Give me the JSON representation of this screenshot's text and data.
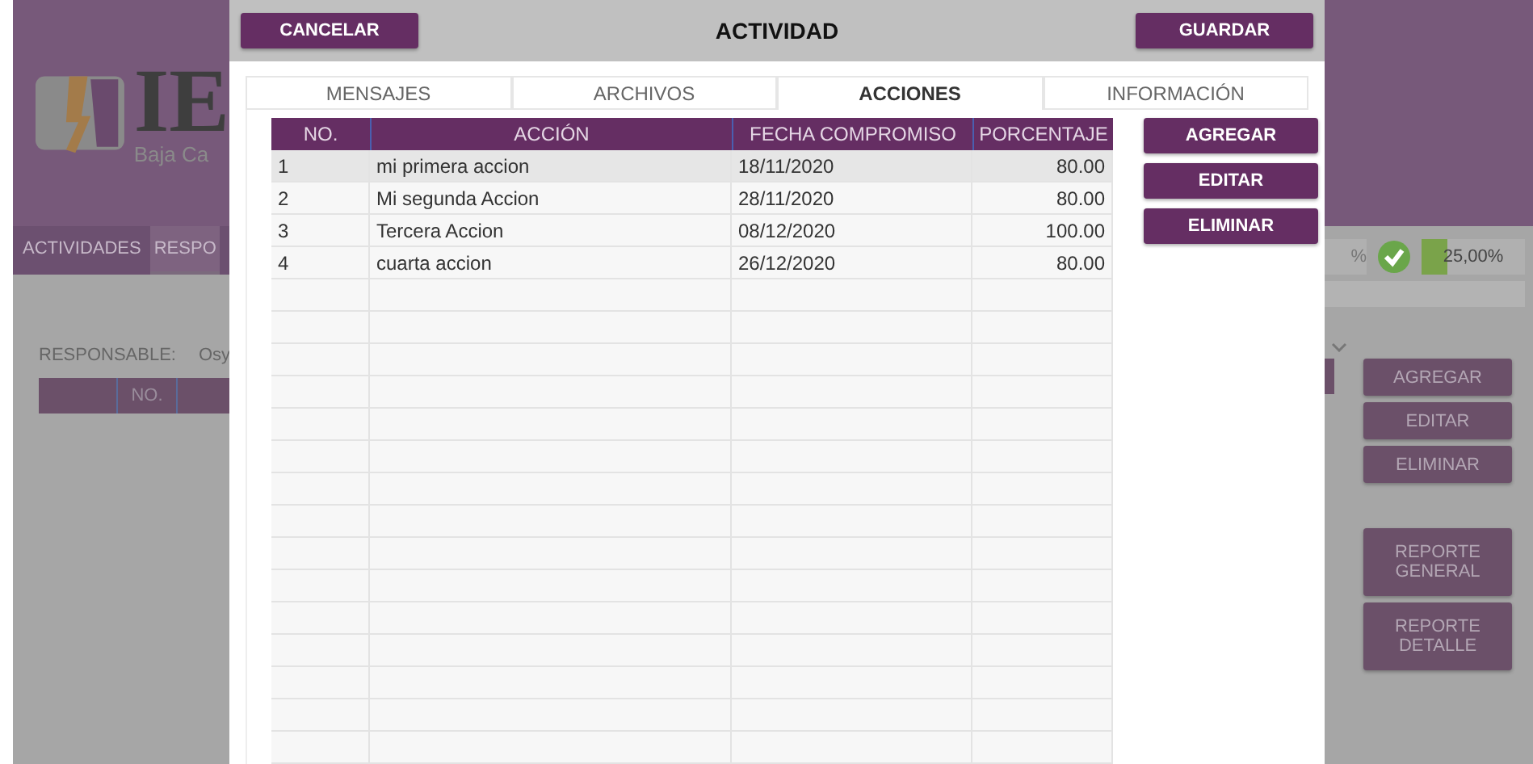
{
  "background": {
    "logo_text": "IE",
    "logo_subtitle": "Baja Ca",
    "nav": [
      {
        "label": "ACTIVIDADES",
        "selected": false
      },
      {
        "label": "RESPO",
        "selected": true
      }
    ],
    "responsable_label": "RESPONSABLE:",
    "responsable_value": "Osy",
    "table_header": [
      "NO."
    ],
    "progress_left": "%",
    "progress": {
      "reading": "25,00%",
      "level": 0.25
    },
    "buttons": [
      "AGREGAR",
      "EDITAR",
      "ELIMINAR",
      "REPORTE GENERAL",
      "REPORTE DETALLE"
    ]
  },
  "modal": {
    "title": "ACTIVIDAD",
    "cancel": "CANCELAR",
    "save": "GUARDAR",
    "tabs": [
      {
        "label": "MENSAJES",
        "selected": false
      },
      {
        "label": "ARCHIVOS",
        "selected": false
      },
      {
        "label": "ACCIONES",
        "selected": true
      },
      {
        "label": "INFORMACIÓN",
        "selected": false
      }
    ],
    "table": {
      "columns": [
        "NO.",
        "ACCIÓN",
        "FECHA COMPROMISO",
        "PORCENTAJE"
      ],
      "rows": [
        {
          "no": "1",
          "accion": "mi primera accion",
          "fecha": "18/11/2020",
          "porcentaje": "80.00",
          "selected": true
        },
        {
          "no": "2",
          "accion": "Mi segunda Accion",
          "fecha": "28/11/2020",
          "porcentaje": "80.00",
          "selected": false
        },
        {
          "no": "3",
          "accion": "Tercera Accion",
          "fecha": "08/12/2020",
          "porcentaje": "100.00",
          "selected": false
        },
        {
          "no": "4",
          "accion": "cuarta accion",
          "fecha": "26/12/2020",
          "porcentaje": "80.00",
          "selected": false
        }
      ]
    },
    "buttons": [
      "AGREGAR",
      "EDITAR",
      "ELIMINAR"
    ]
  }
}
